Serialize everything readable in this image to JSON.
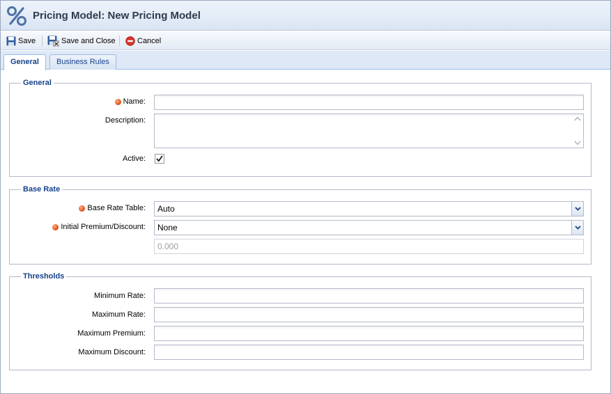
{
  "window": {
    "title": "Pricing Model: New Pricing Model"
  },
  "toolbar": {
    "save": "Save",
    "save_close": "Save and Close",
    "cancel": "Cancel"
  },
  "tabs": [
    {
      "label": "General",
      "active": true
    },
    {
      "label": "Business Rules",
      "active": false
    }
  ],
  "general": {
    "legend": "General",
    "name_label": "Name:",
    "name_value": "",
    "description_label": "Description:",
    "description_value": "",
    "active_label": "Active:",
    "active_checked": true
  },
  "base_rate": {
    "legend": "Base Rate",
    "table_label": "Base Rate Table:",
    "table_value": "Auto",
    "premium_label": "Initial Premium/Discount:",
    "premium_value": "None",
    "amount_value": "0.000"
  },
  "thresholds": {
    "legend": "Thresholds",
    "min_rate_label": "Minimum Rate:",
    "max_rate_label": "Maximum Rate:",
    "max_premium_label": "Maximum Premium:",
    "max_discount_label": "Maximum Discount:"
  },
  "colors": {
    "accent": "#15428b",
    "required": "#e2561c",
    "border": "#b5b8c8"
  }
}
